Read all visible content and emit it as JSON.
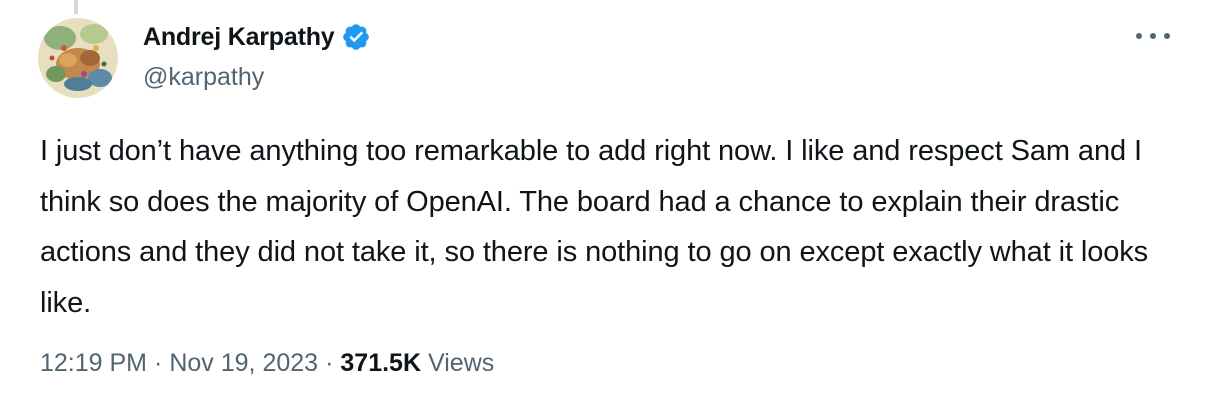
{
  "author": {
    "display_name": "Andrej Karpathy",
    "handle": "@karpathy",
    "verified": true,
    "verified_color": "#1d9bf0"
  },
  "more_menu": {
    "icon": "more-horizontal-icon"
  },
  "tweet": {
    "text": "I just don’t have anything too remarkable to add right now. I like and respect Sam and I think so does the majority of OpenAI. The board had a chance to explain their drastic actions and they did not take it, so there is nothing to go on except exactly what it looks like."
  },
  "meta": {
    "time": "12:19 PM",
    "separator": "·",
    "date": "Nov 19, 2023",
    "views_count": "371.5K",
    "views_label": "Views"
  },
  "colors": {
    "text_primary": "#0f1419",
    "text_secondary": "#536471",
    "accent": "#1d9bf0",
    "thread_line": "#cfd9de"
  }
}
